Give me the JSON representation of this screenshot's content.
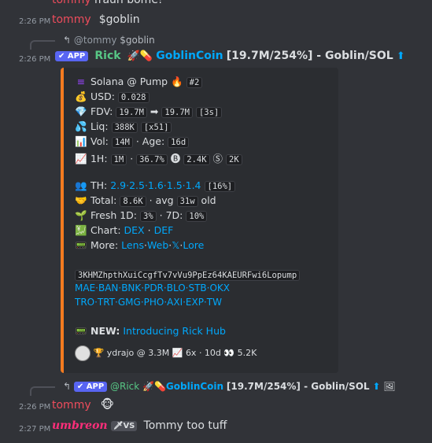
{
  "top_line": {
    "user": "tommy",
    "text": "frauh bome!"
  },
  "msg1": {
    "time": "2:26 PM",
    "user": "tommy",
    "text": "$goblin"
  },
  "reply1": {
    "mention": "@tommy",
    "text": "$goblin"
  },
  "msg2": {
    "time": "2:26 PM",
    "app_badge": "✔ APP",
    "user": "Rick",
    "icons": "🚀💊",
    "coin_link": "GoblinCoin",
    "detail": "[19.7M/254%] - Goblin/SOL",
    "arrow": "⬆"
  },
  "embed": {
    "l1": {
      "icon": "≡",
      "text": "Solana @ Pump",
      "fire": "🔥",
      "code": "#2"
    },
    "l2": {
      "icon": "💰",
      "label": "USD:",
      "code": "0.028"
    },
    "l3": {
      "icon": "💎",
      "label": "FDV:",
      "code1": "19.7M",
      "arrow": "➡",
      "code2": "19.7M",
      "code3": "[3s]"
    },
    "l4": {
      "icon": "💦",
      "label": "Liq:",
      "code1": "388K",
      "code2": "[x51]"
    },
    "l5": {
      "icon": "📊",
      "label": "Vol:",
      "code1": "14M",
      "sep": "· Age:",
      "code2": "16d"
    },
    "l6": {
      "icon": "📈",
      "label": "1H:",
      "code1": "1M",
      "sep": "·",
      "code2": "36.7%",
      "b_icon": "🅑",
      "code3": "2.4K",
      "s_icon": "Ⓢ",
      "code4": "2K"
    },
    "l7": {
      "icon": "👥",
      "label": "TH:",
      "links": "2.9·2.5·1.6·1.5·1.4",
      "code": "[16%]"
    },
    "l8": {
      "icon": "🤝",
      "label": "Total:",
      "code1": "8.6K",
      "sep": "· avg",
      "code2": "31w",
      "tail": "old"
    },
    "l9": {
      "icon": "🌱",
      "label": "Fresh 1D:",
      "code1": "3%",
      "sep": "· 7D:",
      "code2": "10%"
    },
    "l10": {
      "icon": "💹",
      "label": "Chart:",
      "link1": "DEX",
      "sep": "·",
      "link2": "DEF"
    },
    "l11": {
      "icon": "📟",
      "label": "More:",
      "link1": "Lens",
      "link2": "Web",
      "link3": "𝕏",
      "link4": "Lore",
      "sep": "·"
    },
    "address": "3KHMZhpthXuiCcgfTv7vVu9PpEz64KAEURFwi6Lopump",
    "exch1": "MAE·BAN·BNK·PDR·BLO·STB·OKX",
    "exch2": "TRO·TRT·GMG·PHO·AXI·EXP·TW",
    "news": {
      "icon": "📟",
      "label": "NEW:",
      "link": "Introducing Rick Hub"
    },
    "footer": {
      "trophy": "🏆",
      "text": "ydrajo @ 3.3M",
      "chart_icon": "📈",
      "stats": "6x · 10d",
      "eyes": "👀",
      "views": "5.2K"
    }
  },
  "reply2": {
    "app_badge": "✔ APP",
    "mention": "@Rick",
    "icons": "🚀💊",
    "coin_link": "GoblinCoin",
    "detail": "[19.7M/254%] - Goblin/SOL",
    "arrow": "⬆",
    "image_icon": "🖼"
  },
  "msg3": {
    "time": "2:26 PM",
    "user": "tommy",
    "emoji": "🐵"
  },
  "msg4": {
    "time": "2:27 PM",
    "user": "umbreon",
    "badge_icon": "🗡",
    "badge": "VS",
    "text": "Tommy too tuff"
  }
}
